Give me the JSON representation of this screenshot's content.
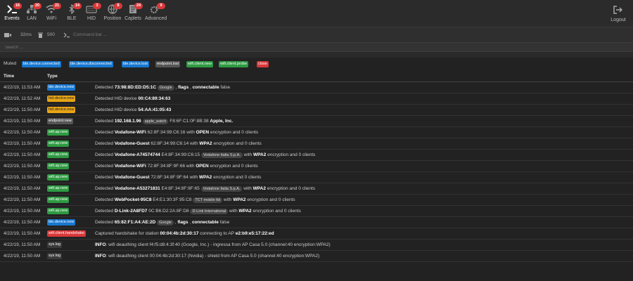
{
  "nav": {
    "items": [
      {
        "label": "Events",
        "badge": "16",
        "icon": "terminal-icon"
      },
      {
        "label": "LAN",
        "badge": "20",
        "icon": "lan-icon"
      },
      {
        "label": "WiFi",
        "badge": "21",
        "icon": "wifi-icon"
      },
      {
        "label": "BLE",
        "badge": "14",
        "icon": "bluetooth-icon"
      },
      {
        "label": "HID",
        "badge": "3",
        "icon": "keyboard-icon"
      },
      {
        "label": "Position",
        "badge": "8",
        "icon": "globe-icon"
      },
      {
        "label": "Caplets",
        "badge": "24",
        "icon": "script-icon"
      },
      {
        "label": "Advanced",
        "badge": "9",
        "icon": "gears-icon"
      }
    ],
    "logout": "Logout"
  },
  "toolbar": {
    "refresh": "32ms",
    "limit": "500",
    "command_placeholder": "Command bar ...",
    "search_placeholder": "Search ..."
  },
  "muted": {
    "label": "Muted",
    "tags": [
      {
        "text": "ble.device.connected",
        "color": "blue"
      },
      {
        "text": "ble.device.disconnected",
        "color": "blue"
      },
      {
        "text": "ble.device.lost",
        "color": "blue"
      },
      {
        "text": "endpoint.lost",
        "color": "gray"
      },
      {
        "text": "wifi.client.new",
        "color": "green"
      },
      {
        "text": "wifi.client.probe",
        "color": "green"
      },
      {
        "text": "close",
        "color": "red"
      }
    ]
  },
  "table": {
    "headers": {
      "time": "Time",
      "type": "Type"
    },
    "rows": [
      {
        "time": "4/22/19, 11:53 AM",
        "type": "ble.device.new",
        "color": "blue"
      },
      {
        "time": "4/22/19, 11:52 AM",
        "type": "hid.device.new",
        "color": "yellow"
      },
      {
        "time": "4/22/19, 11:50 AM",
        "type": "hid.device.new",
        "color": "yellow"
      },
      {
        "time": "4/22/19, 11:50 AM",
        "type": "endpoint.new",
        "color": "gray"
      },
      {
        "time": "4/22/19, 11:50 AM",
        "type": "wifi.ap.new",
        "color": "green"
      },
      {
        "time": "4/22/19, 11:50 AM",
        "type": "wifi.ap.new",
        "color": "green"
      },
      {
        "time": "4/22/19, 11:50 AM",
        "type": "wifi.ap.new",
        "color": "green"
      },
      {
        "time": "4/22/19, 11:50 AM",
        "type": "wifi.ap.new",
        "color": "green"
      },
      {
        "time": "4/22/19, 11:50 AM",
        "type": "wifi.ap.new",
        "color": "green"
      },
      {
        "time": "4/22/19, 11:50 AM",
        "type": "wifi.ap.new",
        "color": "green"
      },
      {
        "time": "4/22/19, 11:50 AM",
        "type": "wifi.ap.new",
        "color": "green"
      },
      {
        "time": "4/22/19, 11:50 AM",
        "type": "wifi.ap.new",
        "color": "green"
      },
      {
        "time": "4/22/19, 11:50 AM",
        "type": "ble.device.new",
        "color": "blue"
      },
      {
        "time": "4/22/19, 11:50 AM",
        "type": "wifi.client.handshake",
        "color": "red"
      },
      {
        "time": "4/22/19, 11:50 AM",
        "type": "sys.log",
        "color": "dark"
      },
      {
        "time": "4/22/19, 11:50 AM",
        "type": "sys.log",
        "color": "dark"
      }
    ],
    "messages": [
      {
        "parts": [
          [
            "t",
            "Detected "
          ],
          [
            "b",
            "73:98:8D:ED:D5:1C"
          ],
          [
            "t",
            " "
          ],
          [
            "c",
            "Google"
          ],
          [
            "t",
            " , "
          ],
          [
            "b",
            "flags"
          ],
          [
            "t",
            " , "
          ],
          [
            "b",
            "connectable"
          ],
          [
            "t",
            " false"
          ]
        ]
      },
      {
        "parts": [
          [
            "t",
            "Detected HID device "
          ],
          [
            "b",
            "00:C4:89:34:63"
          ]
        ]
      },
      {
        "parts": [
          [
            "t",
            "Detected HID device "
          ],
          [
            "b",
            "54:AA:41:05:43"
          ]
        ]
      },
      {
        "parts": [
          [
            "t",
            "Detected "
          ],
          [
            "b",
            "192.168.1.96"
          ],
          [
            "t",
            " "
          ],
          [
            "c",
            "apple_watch"
          ],
          [
            "t",
            " F8:6F:C1:0F:8B:38 "
          ],
          [
            "b",
            "Apple, Inc."
          ]
        ]
      },
      {
        "parts": [
          [
            "t",
            "Detected "
          ],
          [
            "b",
            "Vodafone-WiFi"
          ],
          [
            "t",
            " 62:8F:34:99:C6:16 with "
          ],
          [
            "b",
            "OPEN"
          ],
          [
            "t",
            " encryption and 0 clients"
          ]
        ]
      },
      {
        "parts": [
          [
            "t",
            "Detected "
          ],
          [
            "b",
            "Vodafone-Guest"
          ],
          [
            "t",
            " 62:8F:34:99:C6:14 with "
          ],
          [
            "b",
            "WPA2"
          ],
          [
            "t",
            " encryption and 0 clients"
          ]
        ]
      },
      {
        "parts": [
          [
            "t",
            "Detected "
          ],
          [
            "b",
            "Vodafone-A74574744"
          ],
          [
            "t",
            " E4:8F:34:99:C6:15 "
          ],
          [
            "c",
            "Vodafone Italia S.p.A."
          ],
          [
            "t",
            " with "
          ],
          [
            "b",
            "WPA2"
          ],
          [
            "t",
            " encryption and 0 clients"
          ]
        ]
      },
      {
        "parts": [
          [
            "t",
            "Detected "
          ],
          [
            "b",
            "Vodafone-WiFi"
          ],
          [
            "t",
            " 72:8F:34:8F:9F:66 with "
          ],
          [
            "b",
            "OPEN"
          ],
          [
            "t",
            " encryption and 0 clients"
          ]
        ]
      },
      {
        "parts": [
          [
            "t",
            "Detected "
          ],
          [
            "b",
            "Vodafone-Guest"
          ],
          [
            "t",
            " 72:8F:34:8F:9F:64 with "
          ],
          [
            "b",
            "WPA2"
          ],
          [
            "t",
            " encryption and 0 clients"
          ]
        ]
      },
      {
        "parts": [
          [
            "t",
            "Detected "
          ],
          [
            "b",
            "Vodafone-A53271831"
          ],
          [
            "t",
            " E4:8F:34:8F:9F:65 "
          ],
          [
            "c",
            "Vodafone Italia S.p.A."
          ],
          [
            "t",
            " with "
          ],
          [
            "b",
            "WPA2"
          ],
          [
            "t",
            " encryption and 0 clients"
          ]
        ]
      },
      {
        "parts": [
          [
            "t",
            "Detected "
          ],
          [
            "b",
            "WebPocket-95C8"
          ],
          [
            "t",
            " E4:E1:30:3F:95:C8 "
          ],
          [
            "c",
            "TCT mobile ltd"
          ],
          [
            "t",
            " with "
          ],
          [
            "b",
            "WPA2"
          ],
          [
            "t",
            " encryption and 0 clients"
          ]
        ]
      },
      {
        "parts": [
          [
            "t",
            "Detected "
          ],
          [
            "b",
            "D-Link-2A8FD7"
          ],
          [
            "t",
            " 0C:B6:D2:2A:8F:D8 "
          ],
          [
            "c",
            "D-Link International"
          ],
          [
            "t",
            " with "
          ],
          [
            "b",
            "WPA2"
          ],
          [
            "t",
            " encryption and 0 clients"
          ]
        ]
      },
      {
        "parts": [
          [
            "t",
            "Detected "
          ],
          [
            "b",
            "65:82:F1:A4:AE:2D"
          ],
          [
            "t",
            " "
          ],
          [
            "c",
            "Google"
          ],
          [
            "t",
            " , "
          ],
          [
            "b",
            "flags"
          ],
          [
            "t",
            " , "
          ],
          [
            "b",
            "connectable"
          ],
          [
            "t",
            " false"
          ]
        ]
      },
      {
        "parts": [
          [
            "t",
            "Captured handshake for station "
          ],
          [
            "b",
            "00:04:4b:2d:30:17"
          ],
          [
            "t",
            " connecting to AP "
          ],
          [
            "b",
            "e2:b9:e5:17:22:ed"
          ]
        ]
      },
      {
        "parts": [
          [
            "b",
            "INFO"
          ],
          [
            "t",
            ": wifi deauthing client f4:f5:d8:4:3f:40 (Google, Inc.) - ingressa from AP Casa 5.0 (channel:40 encryption:WPA2)"
          ]
        ]
      },
      {
        "parts": [
          [
            "b",
            "INFO"
          ],
          [
            "t",
            ": wifi deauthing client 00:04:4b:2d:30:17 (Nvidia) - shield from AP Casa 5.0 (channel:40 encryption:WPA2)"
          ]
        ]
      }
    ]
  }
}
